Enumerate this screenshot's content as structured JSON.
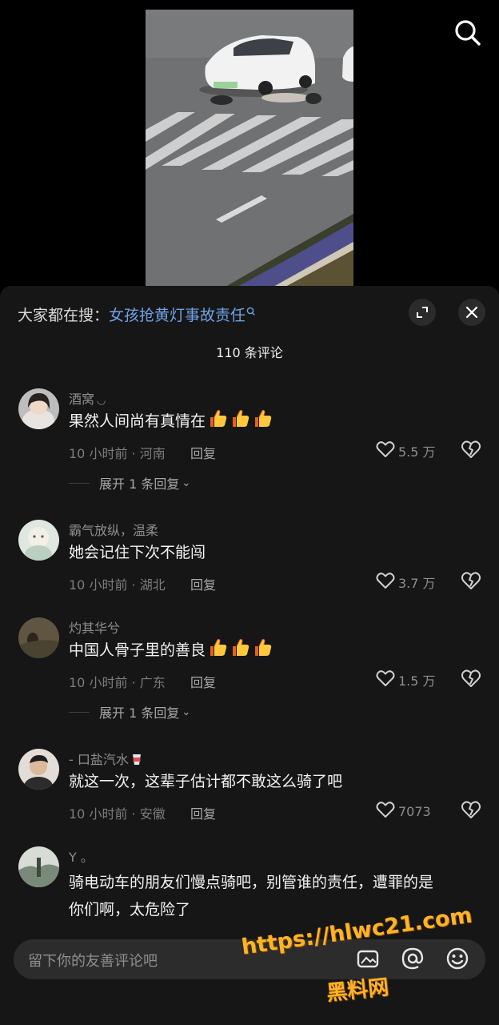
{
  "search_bar": {
    "prefix": "大家都在搜：",
    "query": "女孩抢黄灯事故责任"
  },
  "comments_header": {
    "count_text": "110 条评论"
  },
  "comments": [
    {
      "username": "酒窝",
      "text": "果然人间尚有真情在",
      "thumbs": 3,
      "time": "10 小时前",
      "location": "河南",
      "reply_label": "回复",
      "likes": "5.5 万",
      "expand_text": "展开 1 条回复",
      "avatar_color": "#c9c9c9"
    },
    {
      "username": "霸气放纵，温柔",
      "text": "她会记住下次不能闯",
      "thumbs": 0,
      "time": "10 小时前",
      "location": "湖北",
      "reply_label": "回复",
      "likes": "3.7 万",
      "expand_text": "",
      "avatar_color": "#cfdcd4"
    },
    {
      "username": "灼其华兮",
      "text": "中国人骨子里的善良",
      "thumbs": 3,
      "time": "10 小时前",
      "location": "广东",
      "reply_label": "回复",
      "likes": "1.5 万",
      "expand_text": "展开 1 条回复",
      "avatar_color": "#6f6046"
    },
    {
      "username": "- 口盐汽水",
      "text": "就这一次，这辈子估计都不敢这么骑了吧",
      "thumbs": 0,
      "time": "10 小时前",
      "location": "安徽",
      "reply_label": "回复",
      "likes": "7073",
      "expand_text": "",
      "avatar_color": "#d8d2c8"
    },
    {
      "username": "Y 。",
      "text": "骑电动车的朋友们慢点骑吧，别管谁的责任，遭罪的是",
      "text_line2": "你们啊，太危险了",
      "thumbs": 0,
      "avatar_color": "#9aa39c"
    }
  ],
  "input_bar": {
    "placeholder": "留下你的友善评论吧"
  },
  "watermark": {
    "url": "https://hlwc21.com",
    "name": "黑料网"
  },
  "icons": {
    "search": "search-icon",
    "collapse": "collapse-icon",
    "close": "close-icon",
    "like": "heart-outline-icon",
    "dislike": "broken-heart-icon",
    "thumbs": "thumbs-up-emoji",
    "image": "image-icon",
    "at": "at-icon",
    "emoji": "emoji-icon"
  },
  "colors": {
    "panel_bg": "#161616",
    "link_blue": "#6fa3e8",
    "watermark_orange": "#ffb326"
  }
}
